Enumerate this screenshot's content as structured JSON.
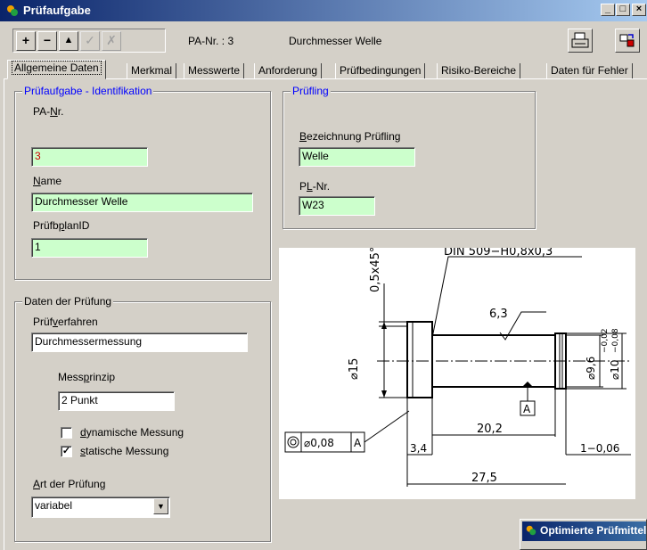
{
  "window": {
    "title": "Prüfaufgabe",
    "minimize": "_",
    "maximize": "□",
    "close": "×"
  },
  "toolbar": {
    "add": "+",
    "remove": "−",
    "up": "▲",
    "confirm": "✓",
    "cancel": "✗",
    "pa_nr": "PA-Nr. : 3",
    "description": "Durchmesser Welle"
  },
  "tabs": [
    "Allgemeine Daten",
    "Merkmal",
    "Messwerte",
    "Anforderung",
    "Prüfbedingungen",
    "Risiko-Bereiche",
    "Daten für Fehler"
  ],
  "ident": {
    "legend": "Prüfaufgabe - Identifikation",
    "pa_nr_pre": "PA-",
    "pa_nr_u": "N",
    "pa_nr_post": "r.",
    "pa_nr_value": "3",
    "name_u": "N",
    "name_post": "ame",
    "name_value": "Durchmesser Welle",
    "planid_pre": "Prüfb",
    "planid_u": "p",
    "planid_post": "lanID",
    "planid_value": "1"
  },
  "pruefling": {
    "legend": "Prüfling",
    "bez_u": "B",
    "bez_post": "ezeichnung Prüfling",
    "bez_value": "Welle",
    "pl_pre": "P",
    "pl_u": "L",
    "pl_post": "-Nr.",
    "pl_value": "W23"
  },
  "pruefung": {
    "legend": "Daten der Prüfung",
    "verf_pre": "Prüf",
    "verf_u": "v",
    "verf_post": "erfahren",
    "verf_value": "Durchmessermessung",
    "prinzip_pre": "Mess",
    "prinzip_u": "p",
    "prinzip_post": "rinzip",
    "prinzip_value": "2 Punkt",
    "dyn_u": "d",
    "dyn_post": "ynamische Messung",
    "dyn_checked": false,
    "stat_u": "s",
    "stat_post": "tatische Messung",
    "stat_checked": true,
    "check_mark": "✓",
    "art_u": "A",
    "art_post": "rt der Prüfung",
    "art_value": "variabel"
  },
  "drawing": {
    "din": "DIN 509−H0,8x0,3",
    "chamfer": "0,5x45°",
    "roughness": "6,3",
    "dia15": "⌀15",
    "dia96": "⌀9,6",
    "dia10": "⌀10",
    "tol_upper": "−0,02",
    "tol_lower": "−0,08",
    "datum": "A",
    "len_20_2": "20,2",
    "len_3_4": "3,4",
    "len_1": "1−0,06",
    "len_27_5": "27,5",
    "fcf_value": "⌀0,08",
    "fcf_datum": "A"
  },
  "subwindow": {
    "title": "Optimierte Prüfmittel"
  },
  "colors": {
    "field_green": "#ccffcc",
    "legend_blue": "#0000ff",
    "title_gradient_start": "#0a246a"
  }
}
